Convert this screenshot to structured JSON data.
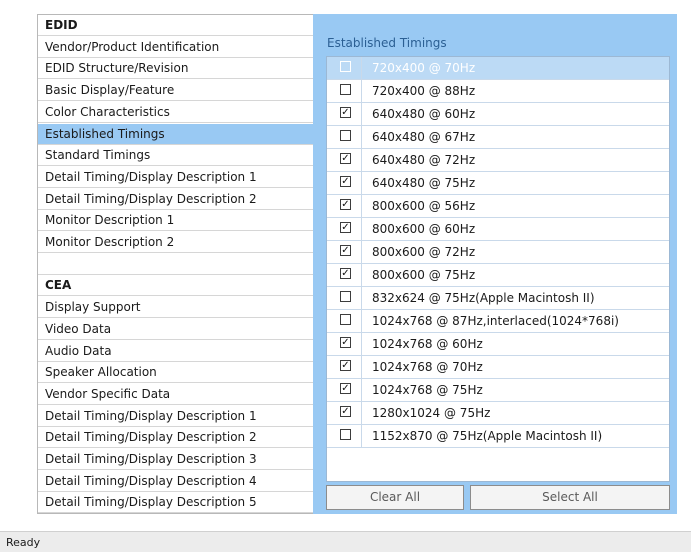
{
  "nav": {
    "items": [
      {
        "label": "EDID",
        "section": true
      },
      {
        "label": "Vendor/Product Identification"
      },
      {
        "label": "EDID Structure/Revision"
      },
      {
        "label": "Basic Display/Feature"
      },
      {
        "label": "Color Characteristics"
      },
      {
        "label": "Established Timings",
        "selected": true
      },
      {
        "label": "Standard Timings"
      },
      {
        "label": "Detail Timing/Display Description 1"
      },
      {
        "label": "Detail Timing/Display Description 2"
      },
      {
        "label": "Monitor Description 1"
      },
      {
        "label": "Monitor Description 2"
      },
      {
        "label": ""
      },
      {
        "label": "CEA",
        "section": true
      },
      {
        "label": "Display Support"
      },
      {
        "label": "Video Data"
      },
      {
        "label": "Audio Data"
      },
      {
        "label": "Speaker Allocation"
      },
      {
        "label": "Vendor Specific Data"
      },
      {
        "label": "Detail Timing/Display Description 1"
      },
      {
        "label": "Detail Timing/Display Description 2"
      },
      {
        "label": "Detail Timing/Display Description 3"
      },
      {
        "label": "Detail Timing/Display Description 4"
      },
      {
        "label": "Detail Timing/Display Description 5"
      }
    ]
  },
  "panel": {
    "title": "Established Timings",
    "check_glyph": "✓",
    "timings": [
      {
        "label": "720x400 @ 70Hz",
        "checked": false,
        "selected": true
      },
      {
        "label": "720x400 @ 88Hz",
        "checked": false
      },
      {
        "label": "640x480 @ 60Hz",
        "checked": true
      },
      {
        "label": "640x480 @ 67Hz",
        "checked": false
      },
      {
        "label": "640x480 @ 72Hz",
        "checked": true
      },
      {
        "label": "640x480 @ 75Hz",
        "checked": true
      },
      {
        "label": "800x600 @ 56Hz",
        "checked": true
      },
      {
        "label": "800x600 @ 60Hz",
        "checked": true
      },
      {
        "label": "800x600 @ 72Hz",
        "checked": true
      },
      {
        "label": "800x600 @ 75Hz",
        "checked": true
      },
      {
        "label": "832x624 @ 75Hz(Apple Macintosh II)",
        "checked": false
      },
      {
        "label": "1024x768 @ 87Hz,interlaced(1024*768i)",
        "checked": false
      },
      {
        "label": "1024x768 @ 60Hz",
        "checked": true
      },
      {
        "label": "1024x768 @ 70Hz",
        "checked": true
      },
      {
        "label": "1024x768 @ 75Hz",
        "checked": true
      },
      {
        "label": "1280x1024 @ 75Hz",
        "checked": true
      },
      {
        "label": "1152x870 @ 75Hz(Apple Macintosh II)",
        "checked": false
      }
    ],
    "clear_all_label": "Clear All",
    "select_all_label": "Select  All"
  },
  "status": {
    "text": "Ready"
  },
  "colors": {
    "panel_bg": "#99c9f3",
    "nav_selected": "#99c9f3",
    "row_selected": "#bcdaf5",
    "title_text": "#2b5f93"
  }
}
